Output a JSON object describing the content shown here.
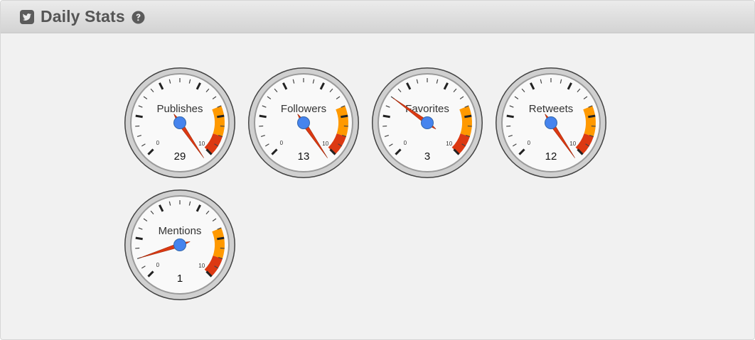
{
  "panel": {
    "title": "Daily Stats",
    "title_icon": "twitter-square-icon",
    "help_icon": "question-circle-icon"
  },
  "gauge_scale": {
    "min": "0",
    "max": "10"
  },
  "colors": {
    "panel_bg": "#f1f1f1",
    "header_text": "#555555",
    "needle": "#dc3912",
    "needle_hub": "#4684ee",
    "yellow_band": "#ff9900",
    "red_band": "#dc3912"
  },
  "gauges": [
    {
      "label": "Publishes",
      "value": "29"
    },
    {
      "label": "Followers",
      "value": "13"
    },
    {
      "label": "Favorites",
      "value": "3"
    },
    {
      "label": "Retweets",
      "value": "12"
    },
    {
      "label": "Mentions",
      "value": "1"
    }
  ]
}
